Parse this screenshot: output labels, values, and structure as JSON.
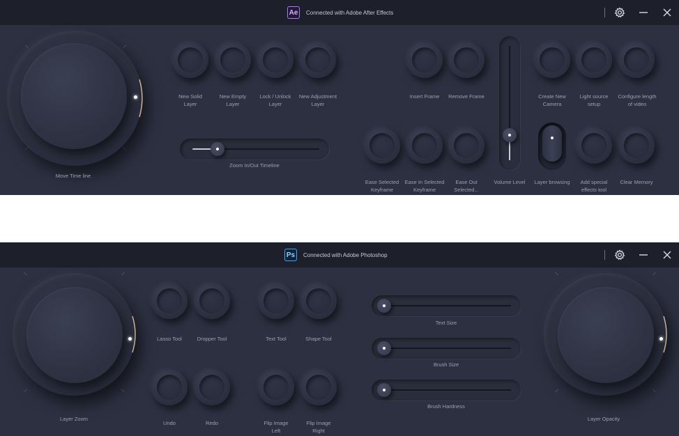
{
  "ae": {
    "app_badge": "Ae",
    "connection_text": "Connected with Adobe After Effects",
    "move_timeline_label": "Move Time line",
    "buttons": [
      {
        "l1": "New Solid",
        "l2": "Layer"
      },
      {
        "l1": "New Empty",
        "l2": "Layer"
      },
      {
        "l1": "Lock / Unlock",
        "l2": "Layer"
      },
      {
        "l1": "New Adjustment",
        "l2": "Layer"
      },
      {
        "l1": "Insert Frame",
        "l2": ""
      },
      {
        "l1": "Remove Frame",
        "l2": ""
      },
      {
        "l1": "Create New",
        "l2": "Camera"
      },
      {
        "l1": "Light source",
        "l2": "setup"
      },
      {
        "l1": "Configure length",
        "l2": "of video"
      },
      {
        "l1": "Ease Selected",
        "l2": "Keyframe"
      },
      {
        "l1": "Ease In Selected",
        "l2": "Keyframe"
      },
      {
        "l1": "Ease Out",
        "l2": "Selected..."
      },
      {
        "l1": "Add special",
        "l2": "effects tool"
      },
      {
        "l1": "Clear Memory",
        "l2": ""
      }
    ],
    "zoom_label": "Zoom In/Out Timeline",
    "zoom_value": 0.2,
    "volume_label": "Volume Level",
    "volume_value": 0.22,
    "layer_browsing_label": "Layer browsing"
  },
  "ps": {
    "app_badge": "Ps",
    "connection_text": "Connected with Adobe Photoshop",
    "layer_zoom_label": "Layer Zoom",
    "layer_opacity_label": "Layer Opacity",
    "buttons": [
      {
        "l1": "Lasso Tool",
        "l2": ""
      },
      {
        "l1": "Dropper Tool",
        "l2": ""
      },
      {
        "l1": "Text Tool",
        "l2": ""
      },
      {
        "l1": "Shape Tool",
        "l2": ""
      },
      {
        "l1": "Undo",
        "l2": ""
      },
      {
        "l1": "Redo",
        "l2": ""
      },
      {
        "l1": "Flip Image",
        "l2": "Left"
      },
      {
        "l1": "Flip Image",
        "l2": "Right"
      }
    ],
    "sliders": [
      {
        "label": "Text Size",
        "value": 0.0
      },
      {
        "label": "Brush Size",
        "value": 0.0
      },
      {
        "label": "Brush Hardness",
        "value": 0.0
      }
    ]
  },
  "icons": {
    "settings": "gear-icon",
    "minimize": "minimize-icon",
    "close": "close-icon"
  },
  "colors": {
    "panel_bg": "#2c3040",
    "titlebar_bg": "#1d202b",
    "ae_accent": "#a47bff",
    "ps_accent": "#31a8ff"
  }
}
